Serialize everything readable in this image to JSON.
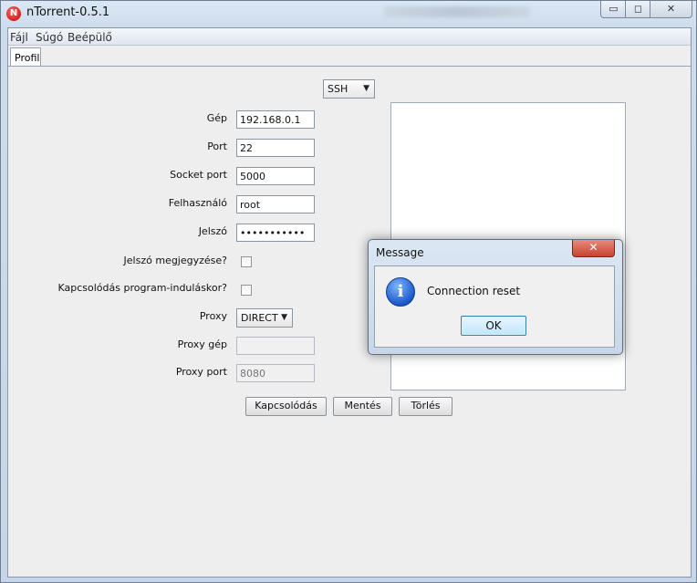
{
  "window": {
    "title": "nTorrent-0.5.1",
    "app_icon_letter": "N",
    "min_glyph": "▭",
    "max_glyph": "◻",
    "close_glyph": "✕"
  },
  "menu": [
    "Fájl",
    "Súgó",
    "Beépülő"
  ],
  "tabs": [
    {
      "label": "Profil",
      "selected": true
    }
  ],
  "form": {
    "connection_type": "SSH",
    "host_label": "Gép",
    "host_value": "192.168.0.1",
    "port_label": "Port",
    "port_value": "22",
    "socket_port_label": "Socket port",
    "socket_port_value": "5000",
    "user_label": "Felhasználó",
    "user_value": "root",
    "password_label": "Jelszó",
    "password_value": "•••••••••••",
    "remember_label": "Jelszó megjegyzése?",
    "remember_checked": false,
    "autoconnect_label": "Kapcsolódás program-induláskor?",
    "autoconnect_checked": false,
    "proxy_label": "Proxy",
    "proxy_value": "DIRECT",
    "proxy_host_label": "Proxy gép",
    "proxy_host_value": "",
    "proxy_port_label": "Proxy port",
    "proxy_port_value": "8080"
  },
  "buttons": {
    "connect": "Kapcsolódás",
    "save": "Mentés",
    "delete": "Törlés"
  },
  "dialog": {
    "title": "Message",
    "message": "Connection reset",
    "ok": "OK",
    "icon": "info-icon",
    "close_glyph": "✕"
  },
  "colors": {
    "titlebar": "#cddcec",
    "client_bg": "#eeeeee",
    "dialog_ok_border": "#3c7fb1",
    "dialog_close": "#c7432f"
  }
}
